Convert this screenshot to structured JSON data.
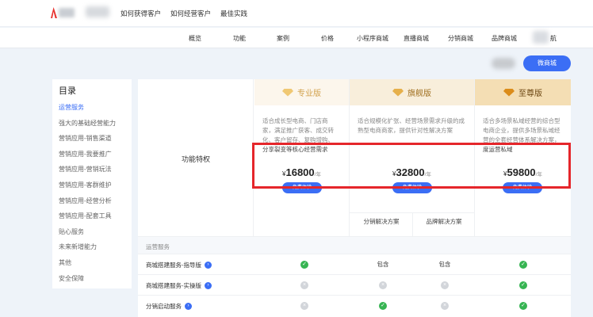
{
  "header": {
    "nav": [
      "如何获得客户",
      "如何经营客户",
      "最佳实践"
    ]
  },
  "subnav": {
    "items": [
      "概览",
      "功能",
      "案例",
      "价格",
      "小程序商城",
      "直播商城",
      "分销商城",
      "品牌商城"
    ],
    "last": "航"
  },
  "actions": {
    "primary": "微商城"
  },
  "sidebar": {
    "title": "目录",
    "items": [
      "运营服务",
      "强大的基础经营能力",
      "营销应用-销售渠道",
      "营销应用-我要推广",
      "营销应用-营销玩法",
      "营销应用-客群维护",
      "营销应用-经营分析",
      "营销应用-配套工具",
      "贴心服务",
      "未来新增能力",
      "其他",
      "安全保障"
    ]
  },
  "table": {
    "feature_label": "功能特权",
    "plans": [
      {
        "name": "专业版",
        "desc": "适合成长型电商、门店商家，满足推广获客、成交转化、客户留存、复购增购、",
        "note": "分享裂变等核心经营需求",
        "price_symbol": "¥",
        "price": "16800",
        "unit": "/年",
        "button": "免费体验"
      },
      {
        "name": "旗舰版",
        "desc": "适合规模化扩张、经营场景需求升级的成熟型电商商家，提供针对性解决方案",
        "note": "",
        "price_symbol": "¥",
        "price": "32800",
        "unit": "/年",
        "button": "免费体验",
        "subs": [
          "分销解决方案",
          "品牌解决方案"
        ]
      },
      {
        "name": "至尊版",
        "desc": "适合多场景私域经营的综合型电商企业，提供多场景私域经营的全套经营体系解决方案，助力深",
        "note": "度运营私域",
        "price_symbol": "¥",
        "price": "59800",
        "unit": "/年",
        "button": "免费体验"
      }
    ],
    "section": "运营服务",
    "rows": [
      {
        "name": "商城搭建服务-指导版",
        "cells": [
          "ok",
          "包含",
          "包含",
          "ok"
        ]
      },
      {
        "name": "商城搭建服务-实操版",
        "cells": [
          "no",
          "no",
          "no",
          "ok"
        ]
      },
      {
        "name": "分销启动服务",
        "cells": [
          "no",
          "ok",
          "no",
          "ok"
        ]
      }
    ]
  }
}
